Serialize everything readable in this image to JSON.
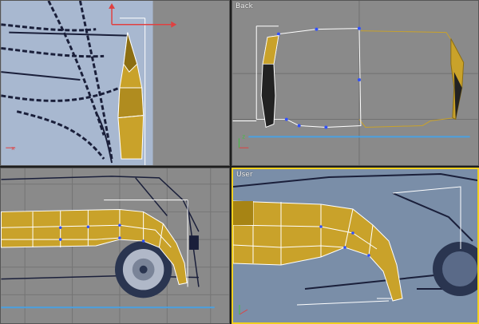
{
  "viewports": {
    "top_left": {
      "label": ""
    },
    "top_right": {
      "label": "Back"
    },
    "bottom_left": {
      "label": ""
    },
    "bottom_right": {
      "label": "User"
    }
  },
  "colors": {
    "viewport_bg": "#8a8a8a",
    "blueprint_bg": "#a8b8d0",
    "mesh_fill": "#c9a22a",
    "mesh_shade": "#8c6e12",
    "wireframe": "#ffffff",
    "active_border": "#f0d020",
    "gizmo_red": "#e04040",
    "gizmo_green": "#40c040",
    "vertex_blue": "#3050ff",
    "ground_line": "#4aa0e0"
  },
  "icons": [
    "axis-tripod-icon",
    "move-gizmo-icon"
  ]
}
